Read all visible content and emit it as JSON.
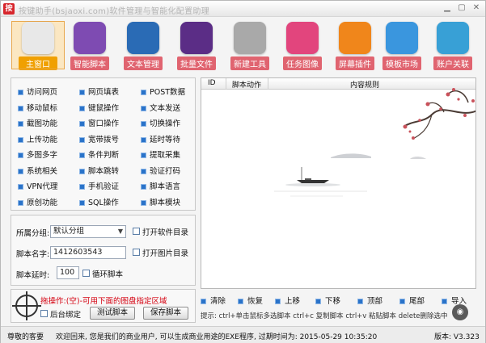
{
  "window": {
    "title": "按键助手(bsjaoxi.com)软件管理与智能化配置助理",
    "app_icon": "按"
  },
  "toolbar": {
    "items": [
      {
        "label": "主窗口",
        "icon": "home-icon",
        "color": "#e8e8e8"
      },
      {
        "label": "智能脚本",
        "icon": "robot-icon",
        "color": "#7e4bb2"
      },
      {
        "label": "文本管理",
        "icon": "notebook-icon",
        "color": "#2a6bb5"
      },
      {
        "label": "批量文件",
        "icon": "pen-icon",
        "color": "#5b2d86"
      },
      {
        "label": "新建工具",
        "icon": "window-icon",
        "color": "#a9a9a9"
      },
      {
        "label": "任务图像",
        "icon": "photo-icon",
        "color": "#e2457d"
      },
      {
        "label": "屏幕插件",
        "icon": "hexagon-icon",
        "color": "#f0861b"
      },
      {
        "label": "模板市场",
        "icon": "gear-icon",
        "color": "#3a96de"
      },
      {
        "label": "账户关联",
        "icon": "chart-icon",
        "color": "#38a0d6"
      }
    ]
  },
  "commands": [
    "访问网页",
    "网页填表",
    "POST数据",
    "移动鼠标",
    "键鼠操作",
    "文本发送",
    "截图功能",
    "窗口操作",
    "切换操作",
    "上传功能",
    "宽带拨号",
    "延时等待",
    "多图多字",
    "条件判断",
    "提取采集",
    "系统相关",
    "脚本跳转",
    "验证打码",
    "VPN代理",
    "手机验证",
    "脚本语言",
    "原创功能",
    "SQL操作",
    "脚本模块"
  ],
  "settings": {
    "group_label": "所属分组:",
    "group_value": "默认分组",
    "open_software_dir": "打开软件目录",
    "script_name_label": "脚本名字:",
    "script_name_value": "1412603543",
    "open_image_dir": "打开图片目录",
    "delay_label": "脚本延时:",
    "delay_value": "100",
    "loop_label": "循环脚本"
  },
  "pick": {
    "tip": "拖操作:(空)-可用下面的图盘指定区域",
    "background_bind": "后台绑定",
    "test_button": "测试脚本",
    "save_button": "保存脚本"
  },
  "table": {
    "columns": [
      "ID",
      "脚本动作",
      "内容规则"
    ]
  },
  "actions": [
    "清除",
    "恢复",
    "上移",
    "下移",
    "顶部",
    "尾部",
    "导入"
  ],
  "hint": "提示: ctrl+单击鼠标多选脚本  ctrl+c 复制脚本  ctrl+v 粘贴脚本  delete删除选中",
  "status": {
    "user": "尊敬的客要",
    "message": "欢迎回来, 您是我们的商业用户, 可以生成商业用途的EXE程序, 过期时间为: 2015-05-29 10:35:20",
    "version": "版本: V3.323"
  }
}
